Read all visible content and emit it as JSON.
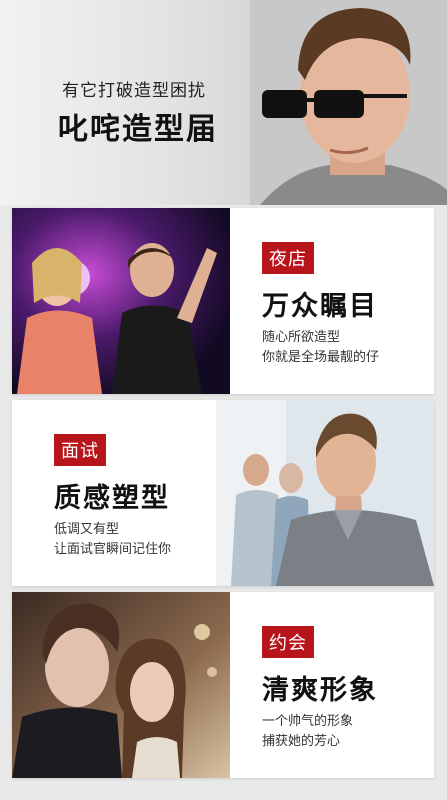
{
  "hero": {
    "subtitle": "有它打破造型困扰",
    "title": "叱咤造型届"
  },
  "cards": [
    {
      "tag": "夜店",
      "headline": "万众瞩目",
      "desc_line1": "随心所欲造型",
      "desc_line2": "你就是全场最靓的仔"
    },
    {
      "tag": "面试",
      "headline": "质感塑型",
      "desc_line1": "低调又有型",
      "desc_line2": "让面试官瞬间记住你"
    },
    {
      "tag": "约会",
      "headline": "清爽形象",
      "desc_line1": "一个帅气的形象",
      "desc_line2": "捕获她的芳心"
    }
  ],
  "colors": {
    "accent": "#b8141b",
    "background": "#e9e9e9",
    "card": "#ffffff"
  }
}
